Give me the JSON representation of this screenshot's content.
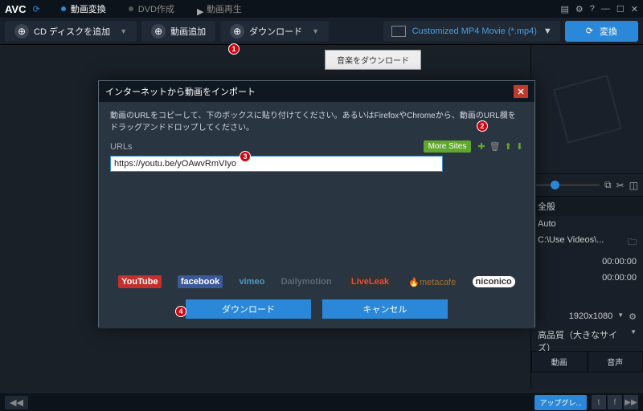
{
  "app": {
    "name": "AVC"
  },
  "tabs": {
    "t1": "動画変換",
    "t2": "DVD作成",
    "t3": "動画再生"
  },
  "toolbar": {
    "addCd": "CD ディスクを追加",
    "addVideo": "動画追加",
    "download": "ダウンロード",
    "formatSel": "Customized MP4 Movie (*.mp4)",
    "convert": "変換"
  },
  "musicTip": "音楽をダウンロード",
  "modal": {
    "title": "インターネットから動画をインポート",
    "desc": "動画のURLをコピーして、下のボックスに貼り付けてください。あるいはFirefoxやChromeから、動画のURL欄をドラッグアンドドロップしてください。",
    "urlsLabel": "URLs",
    "moreSites": "More Sites",
    "urlValue": "https://youtu.be/yOAwvRmVIyo",
    "logos": {
      "yt": "YouTube",
      "fb": "facebook",
      "vm": "vimeo",
      "dm": "Dailymotion",
      "ll1": "Live",
      "ll2": "Leak",
      "mc": "metacafe",
      "nc": "niconico"
    },
    "dlBtn": "ダウンロード",
    "cancelBtn": "キャンセル"
  },
  "side": {
    "general": "全般",
    "auto": "Auto",
    "path": "C:\\Use          Videos\\...",
    "t1": "00:00:00",
    "t2": "00:00:00",
    "res": "1920x1080",
    "quality": "高品質（大きなサイズ）",
    "tabVideo": "動画",
    "tabAudio": "音声"
  },
  "status": {
    "upgrade": "アップグレ..."
  },
  "callouts": {
    "c1": "1",
    "c2": "2",
    "c3": "3",
    "c4": "4"
  }
}
